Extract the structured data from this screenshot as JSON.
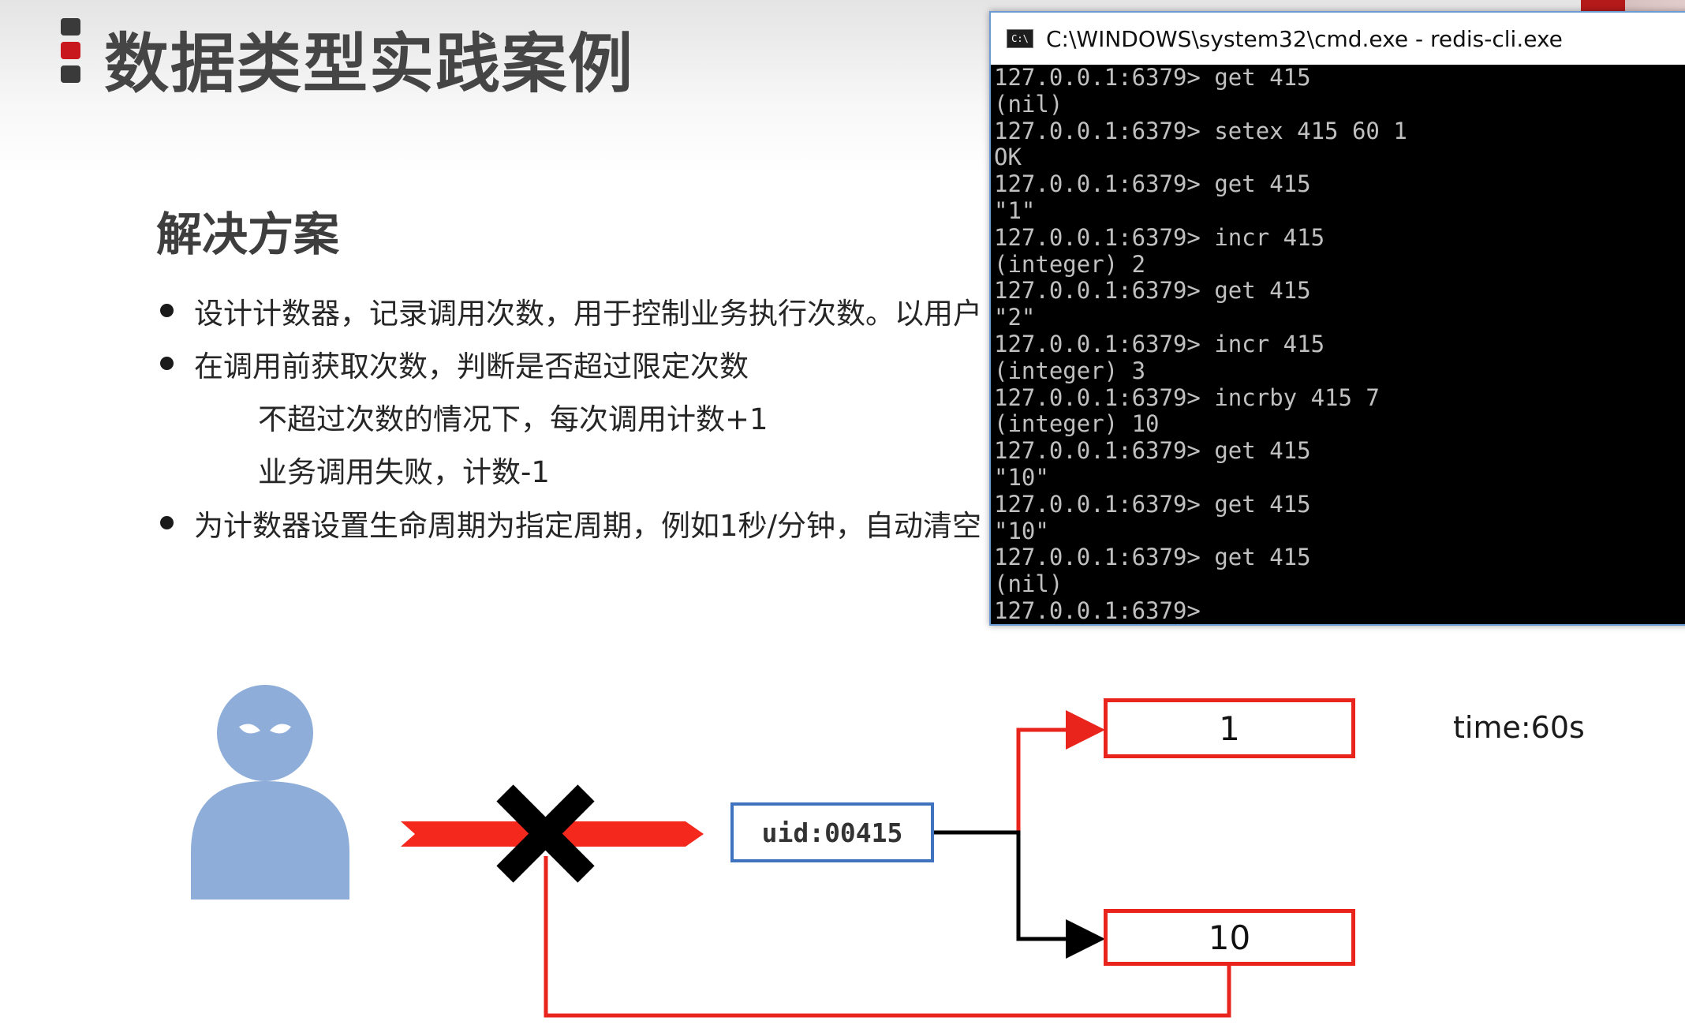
{
  "slide": {
    "title": "数据类型实践案例",
    "section_heading": "解决方案",
    "bullets": [
      "设计计数器，记录调用次数，用于控制业务执行次数。以用户",
      "在调用前获取次数，判断是否超过限定次数",
      "不超过次数的情况下，每次调用计数+1",
      "业务调用失败，计数-1",
      "为计数器设置生命周期为指定周期，例如1秒/分钟，自动清空"
    ]
  },
  "diagram": {
    "uid_label": "uid:00415",
    "counter_top": "1",
    "counter_bottom": "10",
    "time_label": "time:60s",
    "colors": {
      "person": "#8eadd8",
      "arrow_red": "#f4281d",
      "box_border": "#e8241c",
      "uid_border": "#3f73c0",
      "cross": "#000000"
    }
  },
  "cmd": {
    "title": "C:\\WINDOWS\\system32\\cmd.exe - redis-cli.exe",
    "icon_label": "C:\\",
    "lines": [
      "127.0.0.1:6379> get 415",
      "(nil)",
      "127.0.0.1:6379> setex 415 60 1",
      "OK",
      "127.0.0.1:6379> get 415",
      "\"1\"",
      "127.0.0.1:6379> incr 415",
      "(integer) 2",
      "127.0.0.1:6379> get 415",
      "\"2\"",
      "127.0.0.1:6379> incr 415",
      "(integer) 3",
      "127.0.0.1:6379> incrby 415 7",
      "(integer) 10",
      "127.0.0.1:6379> get 415",
      "\"10\"",
      "127.0.0.1:6379> get 415",
      "\"10\"",
      "127.0.0.1:6379> get 415",
      "(nil)",
      "127.0.0.1:6379> "
    ]
  }
}
